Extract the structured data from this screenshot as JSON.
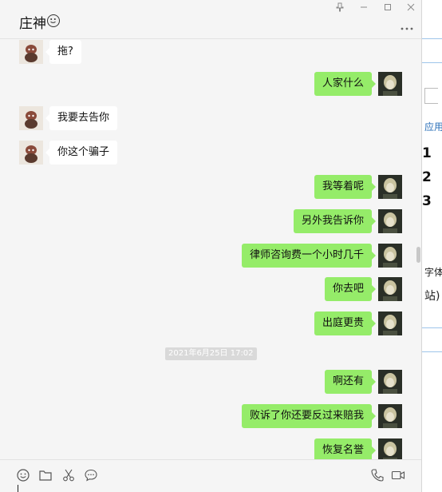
{
  "window": {
    "title": "庄神"
  },
  "messages": [
    {
      "side": "left",
      "text": "拖?"
    },
    {
      "side": "right",
      "text": "人家什么"
    },
    {
      "side": "left",
      "text": "我要去告你"
    },
    {
      "side": "left",
      "text": "你这个骗子"
    },
    {
      "side": "right",
      "text": "我等着呢"
    },
    {
      "side": "right",
      "text": "另外我告诉你"
    },
    {
      "side": "right",
      "text": "律师咨询费一个小时几千"
    },
    {
      "side": "right",
      "text": "你去吧"
    },
    {
      "side": "right",
      "text": "出庭更贵"
    },
    {
      "side": "right",
      "text": "啊还有"
    },
    {
      "side": "right",
      "text": "败诉了你还要反过来赔我"
    },
    {
      "side": "right",
      "text": "恢复名誉"
    }
  ],
  "timestamp": "2021年6月25日 17:02",
  "background_app": {
    "text_1": "应用的",
    "numbers": [
      "1",
      "2",
      "3"
    ],
    "text_2": "字体",
    "text_3": "站)"
  },
  "colors": {
    "bubble_mine": "#95ec69",
    "bubble_theirs": "#ffffff",
    "window_bg": "#f5f5f5"
  },
  "icons": [
    "pin-icon",
    "minimize-icon",
    "maximize-icon",
    "close-icon",
    "more-icon",
    "emoji-icon",
    "folder-icon",
    "scissors-icon",
    "chat-bubble-icon",
    "phone-icon",
    "video-icon"
  ]
}
